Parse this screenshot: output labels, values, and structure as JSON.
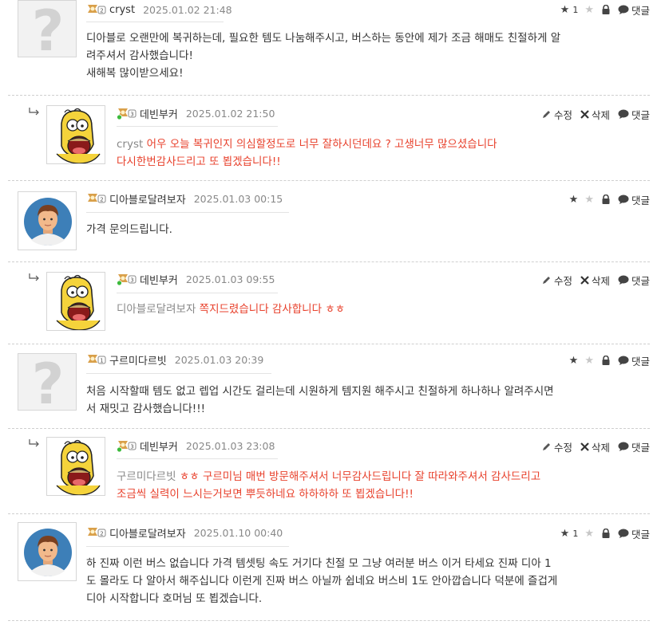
{
  "labels": {
    "reply": "댓글",
    "edit": "수정",
    "delete": "삭제"
  },
  "comments": [
    {
      "avatar": "placeholder-question",
      "level": "2",
      "nick": "cryst",
      "date": "2025.01.02 21:48",
      "recommend_count": "1",
      "lines": [
        "디아블로 오랜만에 복귀하는데, 필요한 템도 나눔해주시고, 버스하는 동안에 제가 조금 해매도 친절하게 알",
        "려주셔서 감사했습니다!",
        "새해복 많이받으세요!"
      ]
    },
    {
      "is_reply": true,
      "avatar": "homer",
      "level": "3",
      "nick": "데빈부커",
      "date": "2025.01.02 21:50",
      "mention": "cryst",
      "lines": [
        "어우 오늘 복귀인지 의심할정도로 너무 잘하시던데요 ? 고생너무 많으셨습니다",
        "다시한번감사드리고 또 뵙겠습니다!!"
      ]
    },
    {
      "avatar": "man",
      "level": "2",
      "nick": "디아블로달려보자",
      "date": "2025.01.03 00:15",
      "lines": [
        "가격 문의드립니다."
      ]
    },
    {
      "is_reply": true,
      "avatar": "homer",
      "level": "3",
      "nick": "데빈부커",
      "date": "2025.01.03 09:55",
      "mention": "디아블로달려보자",
      "lines": [
        "쪽지드렸습니다 감사합니다 ㅎㅎ"
      ]
    },
    {
      "avatar": "placeholder-question",
      "level": "1",
      "nick": "구르미다르빗",
      "date": "2025.01.03 20:39",
      "lines": [
        "처음 시작할때 템도 없고 렙업 시간도 걸리는데 시원하게 템지원 해주시고 친절하게 하나하나 알려주시면",
        "서 재밋고 감사했습니다!!!"
      ]
    },
    {
      "is_reply": true,
      "avatar": "homer",
      "level": "3",
      "nick": "데빈부커",
      "date": "2025.01.03 23:08",
      "mention": "구르미다르빗",
      "lines": [
        "ㅎㅎ 구르미님 매번 방문해주셔서 너무감사드립니다 잘 따라와주셔서 감사드리고",
        "조금씩 실력이 느시는거보면 뿌듯하네요 하하하하 또 뵙겠습니다!!"
      ]
    },
    {
      "avatar": "man",
      "level": "2",
      "nick": "디아블로달려보자",
      "date": "2025.01.10 00:40",
      "recommend_count": "1",
      "lines": [
        "하 진짜 이런 버스 없습니다 가격 템셋팅 속도 거기다 친절 모 그냥 여러분 버스 이거 타세요 진짜 디아 1",
        "도 몰라도 다 알아서 해주십니다 이런게 진짜 버스 아닐까 쉽네요 버스비 1도 안아깝습니다 덕분에 즐겁게",
        "디아 시작합니다 호머님 또 뵙겠습니다."
      ]
    }
  ],
  "colors": {
    "reply_text": "#e8412c",
    "mention": "#888888",
    "divider": "#cfcfcf"
  }
}
